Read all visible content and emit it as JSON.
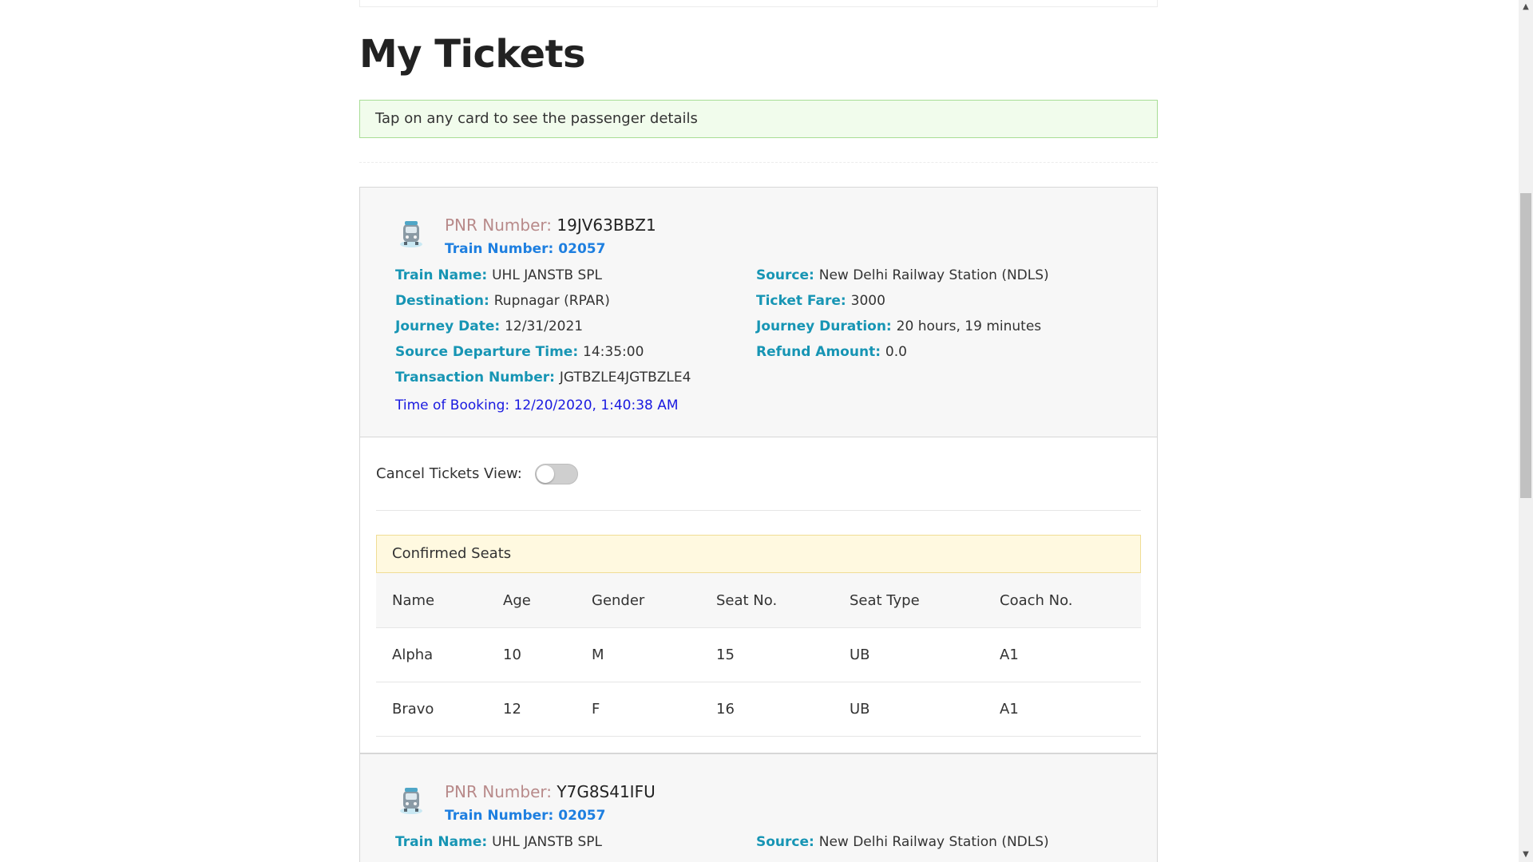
{
  "page": {
    "title": "My Tickets",
    "info_alert": "Tap on any card to see the passenger details"
  },
  "labels": {
    "pnr": "PNR Number: ",
    "train_number": "Train Number: ",
    "train_name": "Train Name: ",
    "source": "Source: ",
    "destination": "Destination: ",
    "ticket_fare": "Ticket Fare: ",
    "journey_date": "Journey Date: ",
    "journey_duration": "Journey Duration: ",
    "departure_time": "Source Departure Time: ",
    "refund_amount": "Refund Amount: ",
    "transaction_number": "Transaction Number: ",
    "time_of_booking": "Time of Booking: ",
    "cancel_view": "Cancel Tickets View:",
    "confirmed_seats": "Confirmed Seats"
  },
  "tickets": [
    {
      "pnr": "19JV63BBZ1",
      "train_number": "02057",
      "train_name": "UHL JANSTB SPL",
      "source": "New Delhi Railway Station (NDLS)",
      "destination": "Rupnagar (RPAR)",
      "ticket_fare": "3000",
      "journey_date": "12/31/2021",
      "journey_duration": "20 hours, 19 minutes",
      "departure_time": "14:35:00",
      "refund_amount": "0.0",
      "transaction_number": "JGTBZLE4JGTBZLE4",
      "time_of_booking": "12/20/2020, 1:40:38 AM",
      "cancel_view_on": false,
      "passengers": {
        "headers": [
          "Name",
          "Age",
          "Gender",
          "Seat No.",
          "Seat Type",
          "Coach No."
        ],
        "rows": [
          [
            "Alpha",
            "10",
            "M",
            "15",
            "UB",
            "A1"
          ],
          [
            "Bravo",
            "12",
            "F",
            "16",
            "UB",
            "A1"
          ]
        ]
      }
    },
    {
      "pnr": "Y7G8S41IFU",
      "train_number": "02057",
      "train_name": "UHL JANSTB SPL",
      "source": "New Delhi Railway Station (NDLS)"
    }
  ],
  "colors": {
    "label_teal": "#1795b4",
    "pnr_label": "#b88a8a",
    "train_number_blue": "#1e7fe0",
    "booking_blue": "#1a1ae0",
    "alert_bg": "#f1fcec",
    "seats_bg": "#fff9e0"
  },
  "icons": {
    "ticket_icon": "train-icon",
    "scroll_up": "scroll-up-arrow-icon",
    "scroll_down": "scroll-down-arrow-icon"
  }
}
